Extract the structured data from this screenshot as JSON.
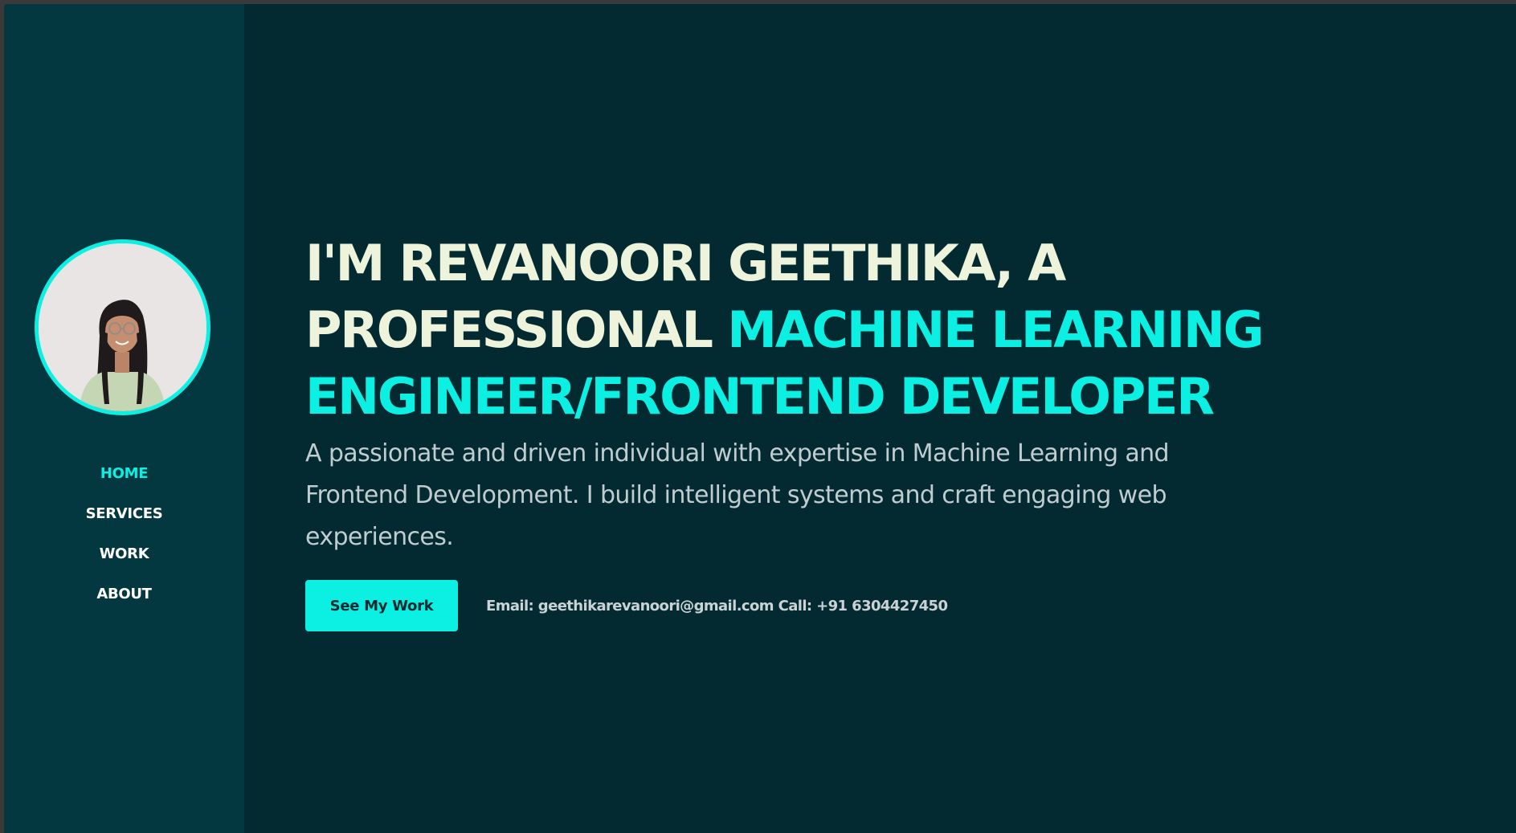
{
  "sidebar": {
    "avatar_alt": "Profile photo",
    "nav": [
      {
        "label": "HOME",
        "active": true
      },
      {
        "label": "SERVICES",
        "active": false
      },
      {
        "label": "WORK",
        "active": false
      },
      {
        "label": "ABOUT",
        "active": false
      }
    ]
  },
  "hero": {
    "headline_plain": "I'M REVANOORI GEETHIKA, A PROFESSIONAL",
    "headline_accent": "MACHINE LEARNING ENGINEER/FRONTEND DEVELOPER",
    "intro": "A passionate and driven individual with expertise in Machine Learning and Frontend Development. I build intelligent systems and craft engaging web experiences.",
    "cta_label": "See My Work",
    "contact": "Email: geethikarevanoori@gmail.com Call: +91 6304427450"
  },
  "colors": {
    "background": "#032a31",
    "sidebar": "#033841",
    "accent": "#0bf0e2",
    "headline": "#eef3dc",
    "body_text": "#bfccd0"
  }
}
